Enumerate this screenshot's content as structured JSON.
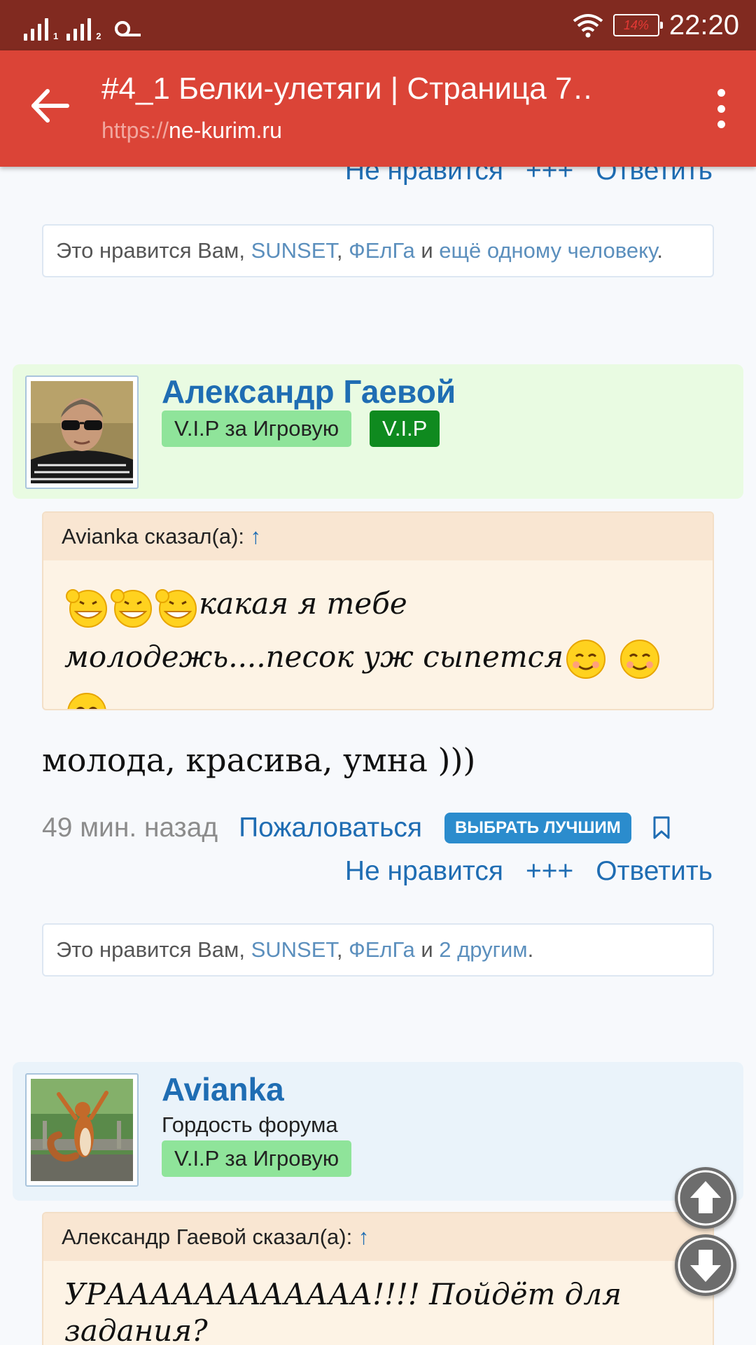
{
  "status_bar": {
    "time": "22:20",
    "battery": "14%",
    "sim1": "1",
    "sim2": "2"
  },
  "app_bar": {
    "title": "#4_1 Белки-улетяги | Страница 7…",
    "url_protocol": "https://",
    "url_host": "ne-kurim.ru"
  },
  "prev_post": {
    "reactions": {
      "dislike": "Не нравится",
      "plus": "+++",
      "reply": "Ответить"
    },
    "likes": {
      "prefix": "Это нравится Вам, ",
      "user1": "SUNSET",
      "sep": ", ",
      "user2": "ФЕлГа",
      "and": " и ",
      "others": "ещё одному человеку",
      "end": "."
    }
  },
  "post1": {
    "author": "Александр Гаевой",
    "badges": [
      "V.I.P за Игровую",
      "V.I.P"
    ],
    "quote": {
      "author_line": "Avianka сказал(а): ",
      "arrow": "↑",
      "text1": "какая я тебе",
      "text2": "молодежь....песок уж сыпется"
    },
    "text": "молода, красива, умна )))",
    "meta": {
      "time": "49 мин. назад",
      "report": "Пожаловаться",
      "best": "ВЫБРАТЬ ЛУЧШИМ"
    },
    "reactions": {
      "dislike": "Не нравится",
      "plus": "+++",
      "reply": "Ответить"
    },
    "likes": {
      "prefix": "Это нравится Вам, ",
      "user1": "SUNSET",
      "sep": ", ",
      "user2": "ФЕлГа",
      "and": " и ",
      "others": "2 другим",
      "end": "."
    }
  },
  "post2": {
    "author": "Avianka",
    "user_title": "Гордость форума",
    "badges": [
      "V.I.P за Игровую"
    ],
    "quote": {
      "author_line": "Александр Гаевой сказал(а): ",
      "arrow": "↑",
      "text1": "УРАААААААААААА!!!! Пойдёт для",
      "text2": "задания?"
    }
  },
  "colors": {
    "status_bar": "#812a20",
    "app_bar": "#db4437",
    "link": "#1f6db3",
    "vip_light": "#8fe49a",
    "vip_dark": "#0f8a1f",
    "best_button": "#2b8ccd"
  },
  "icons": {
    "back": "arrow-left-icon",
    "menu": "more-vert-icon",
    "bookmark": "bookmark-icon",
    "scroll_up": "arrow-up-icon",
    "scroll_down": "arrow-down-icon"
  }
}
